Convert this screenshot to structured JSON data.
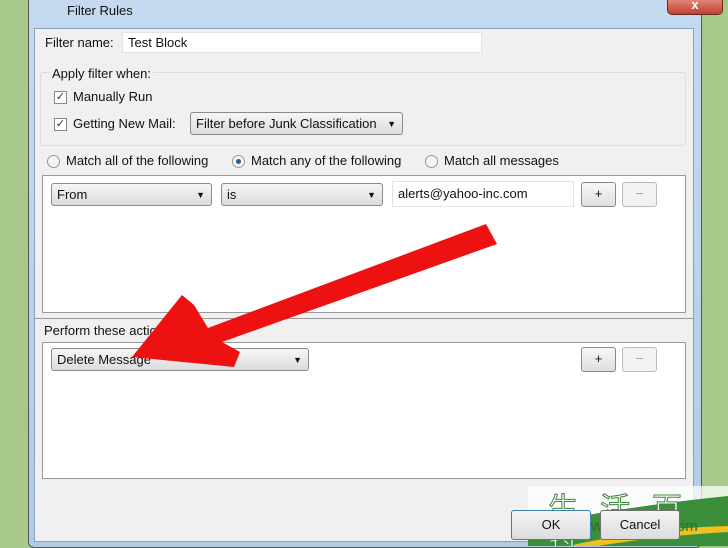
{
  "window": {
    "title": "Filter Rules",
    "close_label": "x"
  },
  "filter_name": {
    "label": "Filter name:",
    "value": "Test Block"
  },
  "apply": {
    "legend": "Apply filter when:",
    "manual_run": {
      "label": "Manually Run",
      "checked": true
    },
    "new_mail": {
      "label": "Getting New Mail:",
      "checked": true
    },
    "timing": "Filter before Junk Classification"
  },
  "match": {
    "options": [
      "Match all of the following",
      "Match any of the following",
      "Match all messages"
    ],
    "selected": "Match any of the following"
  },
  "rule": {
    "field": "From",
    "operator": "is",
    "value": "alerts@yahoo-inc.com",
    "add": "+",
    "remove": "−"
  },
  "actions": {
    "label": "Perform these actions:",
    "action": "Delete Message",
    "add": "+",
    "remove": "−"
  },
  "buttons": {
    "ok": "OK",
    "cancel": "Cancel"
  },
  "watermark": {
    "chars": "生活百科",
    "url": "www.bimeiz.com"
  },
  "annotation": {
    "arrow_color": "#ee1111"
  }
}
